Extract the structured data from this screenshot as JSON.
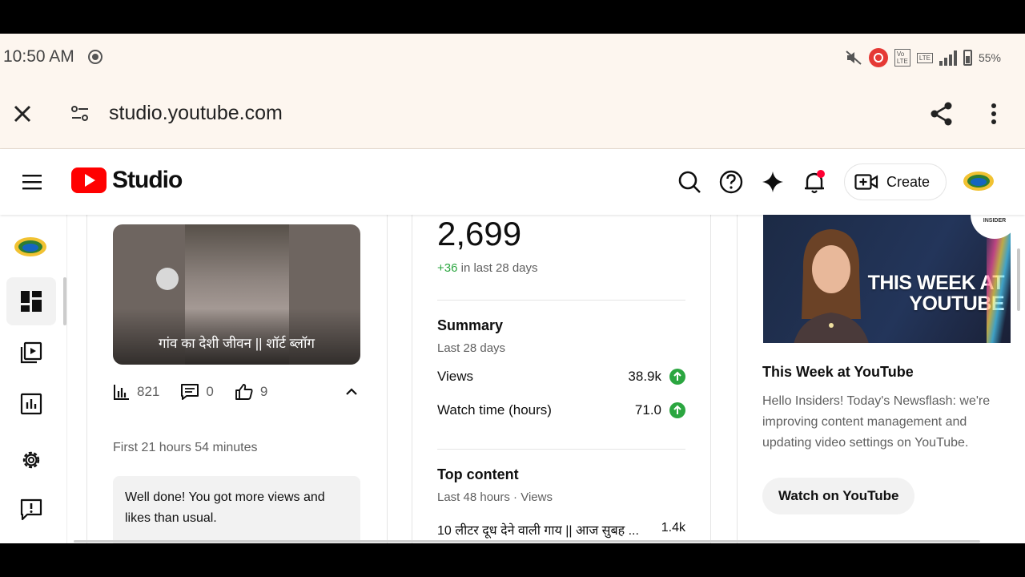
{
  "status_bar": {
    "time": "10:50 AM",
    "battery": "55%",
    "network_label": "LTE"
  },
  "browser": {
    "url": "studio.youtube.com"
  },
  "header": {
    "logo_text": "Studio",
    "create_label": "Create"
  },
  "latest_video": {
    "thumbnail_title": "गांव का देशी जीवन || शॉर्ट ब्लॉग",
    "views": "821",
    "comments": "0",
    "likes": "9",
    "period": "First 21 hours 54 minutes",
    "message": "Well done! You got more views and likes than usual."
  },
  "analytics": {
    "subscribers": "2,699",
    "subscribers_delta": "+36",
    "subscribers_delta_suffix": "in last 28 days",
    "summary_title": "Summary",
    "summary_period": "Last 28 days",
    "rows": [
      {
        "label": "Views",
        "value": "38.9k"
      },
      {
        "label": "Watch time (hours)",
        "value": "71.0"
      }
    ],
    "top_content_title": "Top content",
    "top_content_period": "Last 48 hours · Views",
    "top_item_title": "10 लीटर दूध देने वाली गाय || आज सुबह ...",
    "top_item_views": "1.4k"
  },
  "news": {
    "thumbnail_text": "THIS WEEK AT YOUTUBE",
    "badge_text": "INSIDER",
    "title": "This Week at YouTube",
    "body": "Hello Insiders! Today's Newsflash: we're improving content management and updating video settings on YouTube.",
    "button_label": "Watch on YouTube"
  },
  "colors": {
    "brand_red": "#ff0000",
    "positive_green": "#2ba640",
    "notification_dot": "#ff0033"
  }
}
